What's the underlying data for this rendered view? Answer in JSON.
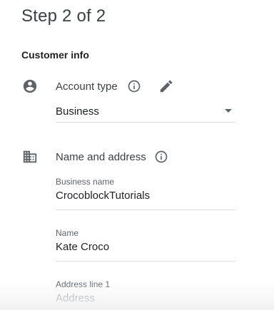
{
  "header": {
    "step_title": "Step 2 of 2"
  },
  "section": {
    "title": "Customer info"
  },
  "account_type": {
    "label": "Account type",
    "value": "Business",
    "icon": "account-circle-icon"
  },
  "name_address": {
    "label": "Name and address",
    "icon": "business-building-icon",
    "fields": {
      "business_name": {
        "label": "Business name",
        "value": "CrocoblockTutorials"
      },
      "name": {
        "label": "Name",
        "value": "Kate Croco"
      },
      "address_line_1": {
        "label": "Address line 1",
        "placeholder": "Address"
      }
    }
  },
  "colors": {
    "icon": "#5f6368",
    "text": "#202124",
    "divider": "#dadce0"
  }
}
